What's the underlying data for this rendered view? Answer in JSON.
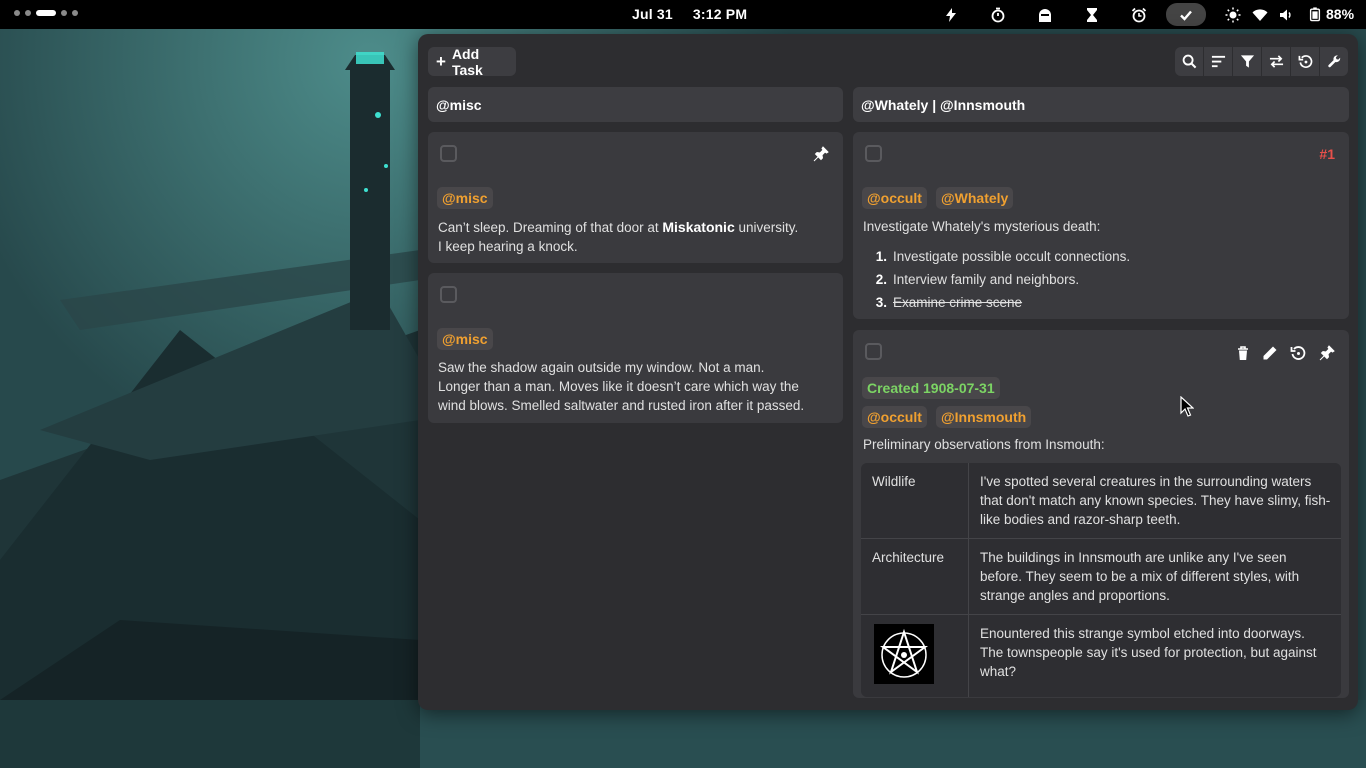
{
  "topbar": {
    "date": "Jul 31",
    "time": "3:12 PM",
    "battery": "88%",
    "tray_icons": [
      "bolt-icon",
      "timer-icon",
      "ghost-icon",
      "hourglass-icon",
      "alarm-icon",
      "check-icon",
      "brightness-icon",
      "wifi-icon",
      "volume-icon",
      "battery-icon"
    ]
  },
  "toolbar": {
    "add_task_label": "Add Task",
    "buttons": [
      "search-icon",
      "sort-icon",
      "filter-icon",
      "swap-icon",
      "undo-icon",
      "wrench-icon"
    ]
  },
  "columns": [
    {
      "header": "@misc",
      "cards": [
        {
          "tags": [
            "@misc"
          ],
          "text_before": "Can’t sleep. Dreaming of that door at ",
          "text_bold": "Miskatonic",
          "text_after": " university.",
          "text_line2": "I keep hearing a knock.",
          "pinned": true
        },
        {
          "tags": [
            "@misc"
          ],
          "text_lines": [
            "Saw the shadow again outside my window. Not a man.",
            "Longer than a man. Moves like it doesn’t care which way the",
            "wind blows. Smelled saltwater and rusted iron after it passed."
          ]
        }
      ]
    },
    {
      "header": "@Whately | @Innsmouth",
      "cards": [
        {
          "priority": "#1",
          "tags": [
            "@occult",
            "@Whately"
          ],
          "text": "Investigate Whately's mysterious death:",
          "steps": [
            {
              "n": "1.",
              "text": "Investigate possible occult connections.",
              "done": false
            },
            {
              "n": "2.",
              "text": "Interview family and neighbors.",
              "done": false
            },
            {
              "n": "3.",
              "text": "Examine crime scene",
              "done": true
            }
          ]
        },
        {
          "created": "Created 1908-07-31",
          "tags": [
            "@occult",
            "@Innsmouth"
          ],
          "text": "Preliminary observations from Insmouth:",
          "actions": [
            "trash-icon",
            "edit-icon",
            "reset-icon",
            "pin-icon"
          ],
          "table": [
            {
              "key": "Wildlife",
              "value": "I've spotted several creatures in the surrounding waters that don't match any known species. They have slimy, fish-like bodies and razor-sharp teeth."
            },
            {
              "key": "Architecture",
              "value": "The buildings in Innsmouth are unlike any I've seen before. They seem to be a mix of different styles, with strange angles and proportions."
            },
            {
              "key": "",
              "image": "pentagram-symbol",
              "value": "Enountered this strange symbol etched into doorways. The townspeople say it's used for protection, but against what?"
            }
          ]
        }
      ]
    }
  ],
  "colors": {
    "tag": "#f0a030",
    "created": "#7cd464",
    "priority": "#e8504a",
    "card_bg": "#3a3a3e",
    "window_bg": "#2d2d30"
  }
}
